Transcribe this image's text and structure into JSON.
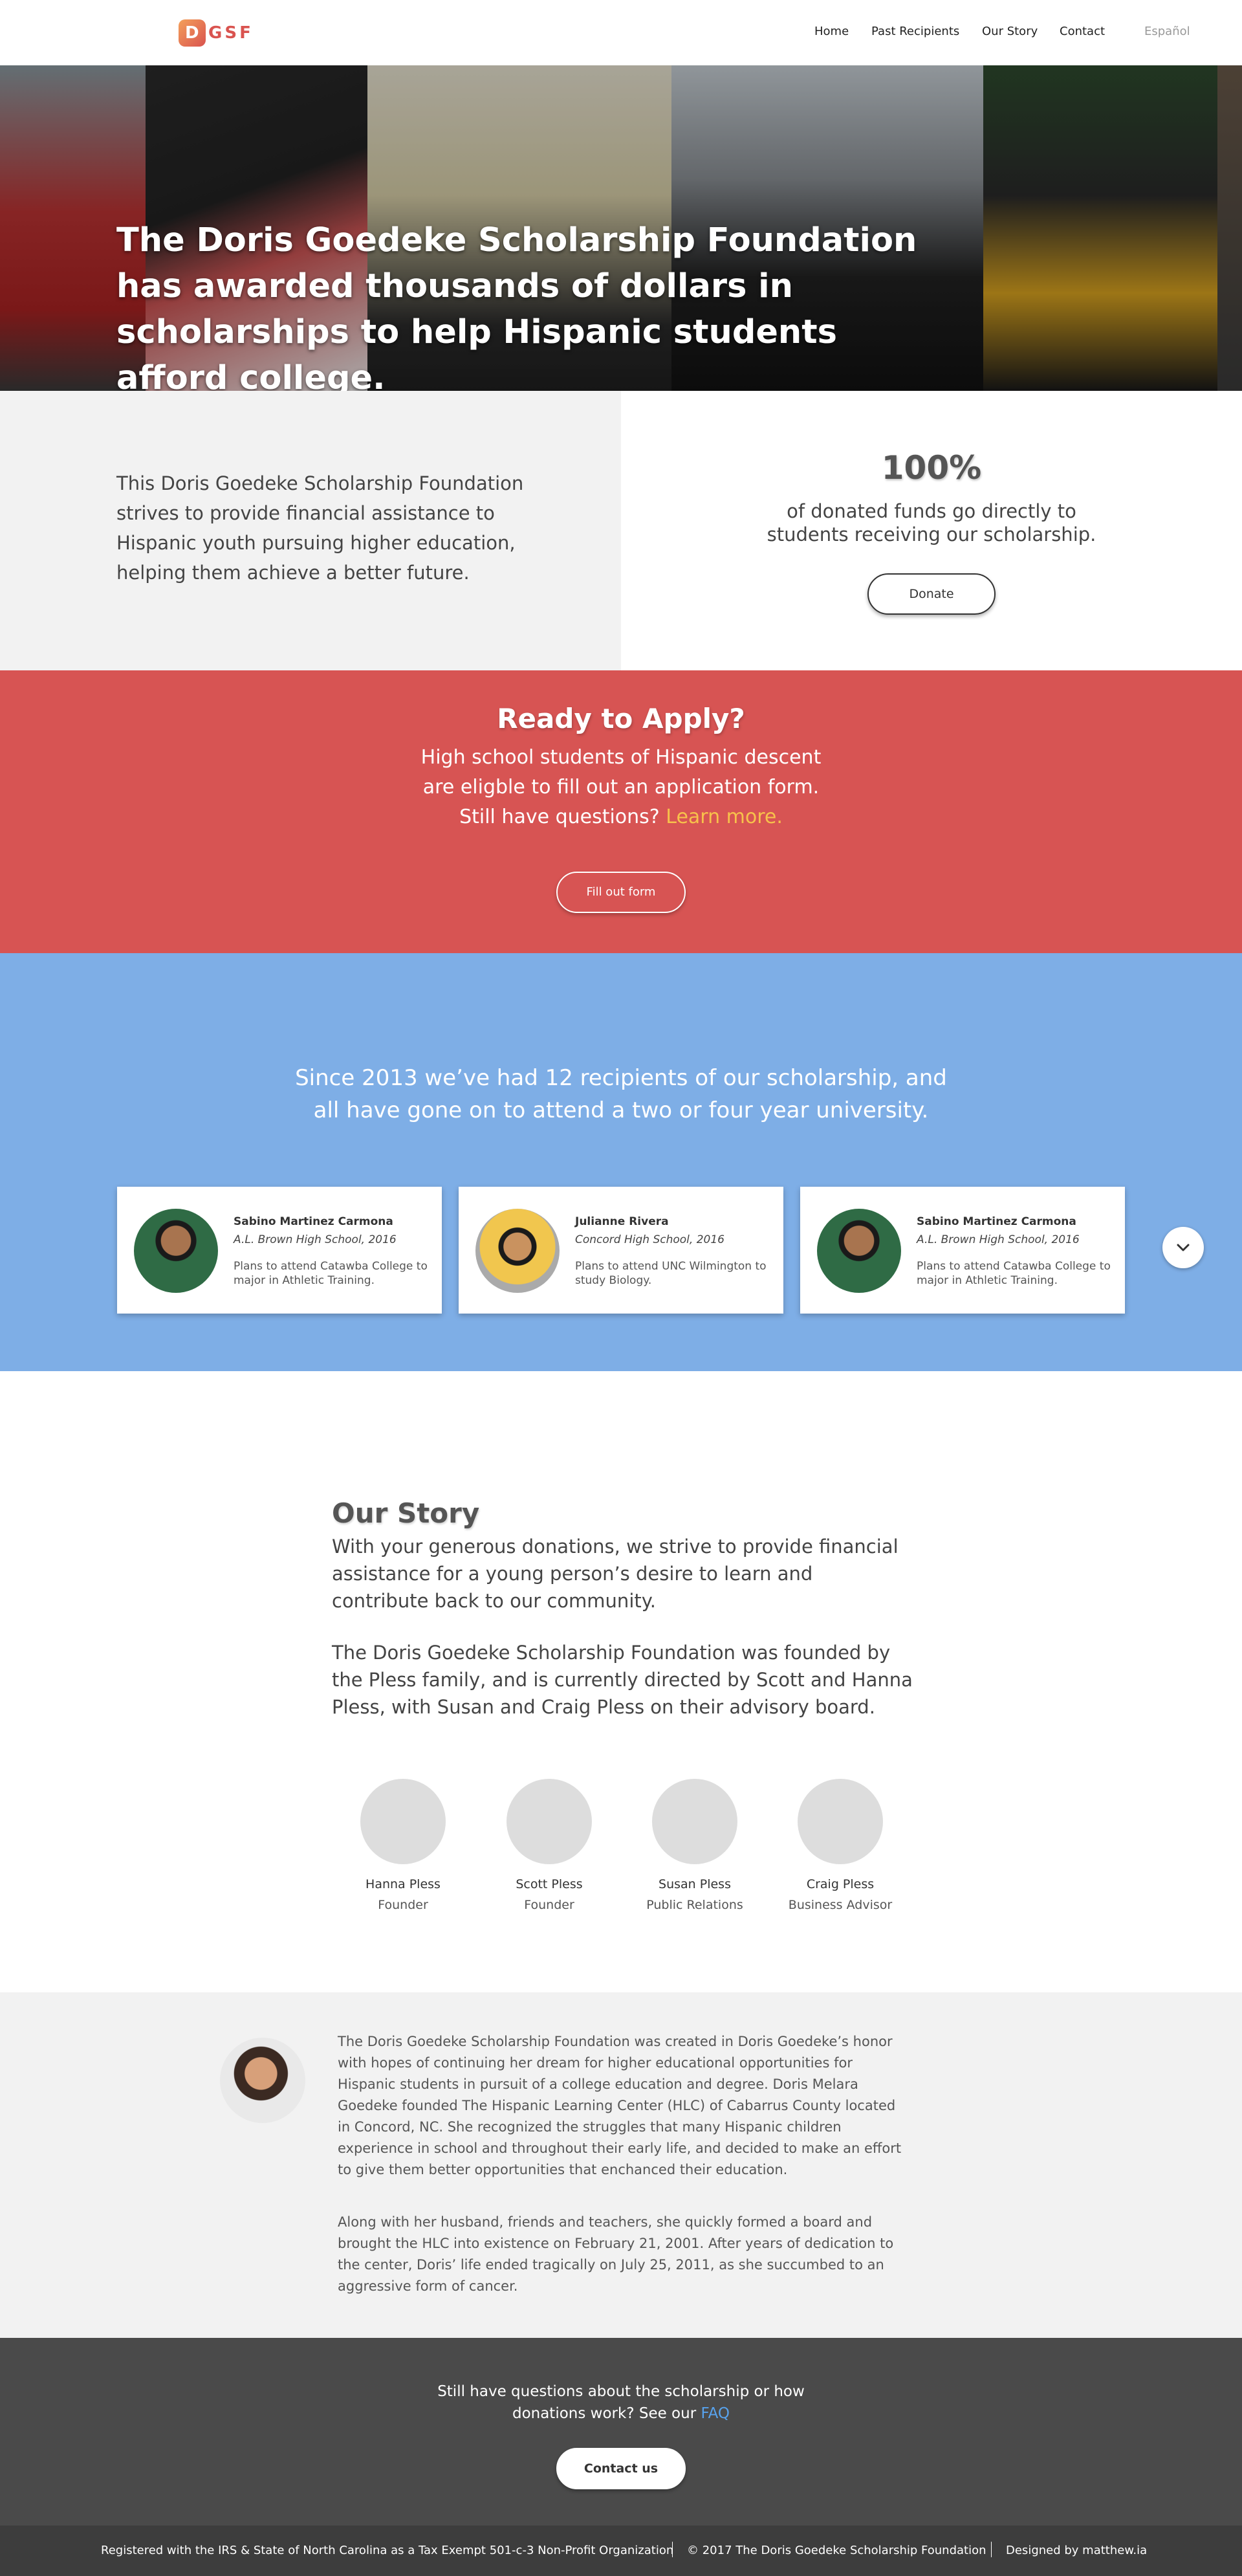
{
  "brand": {
    "logo_letter": "D",
    "logo_text": "GSF"
  },
  "nav": {
    "items": [
      {
        "label": "Home"
      },
      {
        "label": "Past Recipients"
      },
      {
        "label": "Our Story"
      },
      {
        "label": "Contact"
      },
      {
        "label": "Español"
      }
    ]
  },
  "hero": {
    "headline": "The Doris Goedeke Scholarship Foundation has awarded thousands of dollars in scholarships to help Hispanic students afford college."
  },
  "mission": {
    "text": "This Doris Goedeke Scholarship Foundation strives to provide financial assistance to Hispanic youth pursuing higher education, helping them achieve a better future.",
    "stat": "100%",
    "stat_text": "of donated funds go directly to students receiving our scholarship.",
    "donate_label": "Donate"
  },
  "apply": {
    "title": "Ready to Apply?",
    "text": "High school students of Hispanic descent are eligble to fill out an application form. Still have questions?",
    "link": "Learn more.",
    "button": "Fill out form"
  },
  "recipients": {
    "heading": "Since 2013 we’ve had 12 recipients of our scholarship, and all have gone on to attend a two or four year university.",
    "cards": [
      {
        "name": "Sabino Martinez Carmona",
        "school": "A.L. Brown High School, 2016",
        "plan": "Plans to attend Catawba College to major in Athletic Training."
      },
      {
        "name": "Julianne Rivera",
        "school": "Concord High School, 2016",
        "plan": "Plans to attend UNC Wilmington to study Biology."
      },
      {
        "name": "Sabino Martinez Carmona",
        "school": "A.L. Brown High School, 2016",
        "plan": "Plans to attend Catawba College to major in Athletic Training."
      }
    ]
  },
  "story": {
    "title": "Our Story",
    "p1": "With your generous donations, we strive to provide financial assistance for a young person’s desire to learn and contribute back to our community.",
    "p2": "The Doris Goedeke Scholarship Foundation was founded by the Pless family, and is currently directed by Scott and Hanna Pless, with Susan and Craig Pless on their advisory board.",
    "members": [
      {
        "name": "Hanna Pless",
        "role": "Founder"
      },
      {
        "name": "Scott Pless",
        "role": "Founder"
      },
      {
        "name": "Susan Pless",
        "role": "Public Relations"
      },
      {
        "name": "Craig Pless",
        "role": "Business Advisor"
      }
    ]
  },
  "history": {
    "p1": "The Doris Goedeke Scholarship Foundation was created in Doris Goedeke’s honor with hopes of continuing her dream for higher educational opportunities for Hispanic students in pursuit of a college education and degree. Doris Melara Goedeke founded The Hispanic Learning Center (HLC) of Cabarrus County located in Concord, NC.  She recognized the struggles that many Hispanic children experience in school and throughout their early life, and decided to make an effort to give them better opportunities that enchanced their education.",
    "p2": "Along with her husband, friends and teachers, she quickly formed a board and brought the HLC into existence on February 21, 2001.  After years of dedication to the center, Doris’ life ended tragically on July 25, 2011, as she succumbed to an aggressive form of cancer."
  },
  "cta": {
    "text": "Still have questions about the scholarship or how donations work? See our",
    "faq": "FAQ",
    "button": "Contact us"
  },
  "footer": {
    "registration": "Registered with the IRS & State of North Carolina as a Tax Exempt 501-c-3 Non-Profit Organization",
    "copyright": "© 2017 The Doris Goedeke Scholarship Foundation",
    "designer": "Designed by matthew.ia"
  },
  "colors": {
    "accent_red": "#d75453",
    "sky_blue": "#7eaee6",
    "link_blue": "#58a3ee",
    "gold": "#f7c14b"
  },
  "icons": [
    "logo-mark-icon",
    "chevron-down-icon"
  ]
}
